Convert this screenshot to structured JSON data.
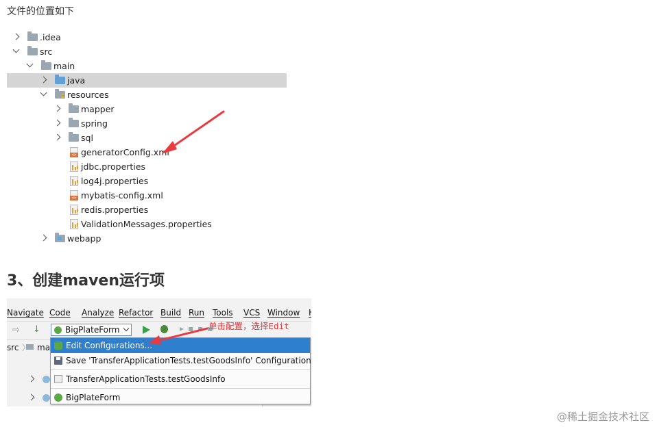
{
  "intro": "文件的位置如下",
  "tree": [
    {
      "label": ".idea",
      "indent": 0,
      "expander": "right",
      "icon": "folder",
      "selected": false
    },
    {
      "label": "src",
      "indent": 0,
      "expander": "down",
      "icon": "folder",
      "selected": false
    },
    {
      "label": "main",
      "indent": 1,
      "expander": "down",
      "icon": "folder",
      "selected": false
    },
    {
      "label": "java",
      "indent": 2,
      "expander": "right",
      "icon": "folder-blue",
      "selected": true
    },
    {
      "label": "resources",
      "indent": 2,
      "expander": "down",
      "icon": "folder-res",
      "selected": false
    },
    {
      "label": "mapper",
      "indent": 3,
      "expander": "right",
      "icon": "folder",
      "selected": false
    },
    {
      "label": "spring",
      "indent": 3,
      "expander": "right",
      "icon": "folder",
      "selected": false
    },
    {
      "label": "sql",
      "indent": 3,
      "expander": "right",
      "icon": "folder",
      "selected": false
    },
    {
      "label": "generatorConfig.xml",
      "indent": 3,
      "expander": "none",
      "icon": "xml",
      "selected": false
    },
    {
      "label": "jdbc.properties",
      "indent": 3,
      "expander": "none",
      "icon": "prop",
      "selected": false
    },
    {
      "label": "log4j.properties",
      "indent": 3,
      "expander": "none",
      "icon": "prop",
      "selected": false
    },
    {
      "label": "mybatis-config.xml",
      "indent": 3,
      "expander": "none",
      "icon": "xml",
      "selected": false
    },
    {
      "label": "redis.properties",
      "indent": 3,
      "expander": "none",
      "icon": "prop",
      "selected": false
    },
    {
      "label": "ValidationMessages.properties",
      "indent": 3,
      "expander": "none",
      "icon": "prop",
      "selected": false
    },
    {
      "label": "webapp",
      "indent": 2,
      "expander": "right",
      "icon": "folder-web",
      "selected": false
    }
  ],
  "heading": "3、创建maven运行项",
  "ide": {
    "menu": [
      "Navigate",
      "Code",
      "Analyze",
      "Refactor",
      "Build",
      "Run",
      "Tools",
      "VCS",
      "Window",
      "H"
    ],
    "run_config": "BigPlateForm",
    "annotation": "单击配置，选择Edit",
    "crumb_src": "src",
    "crumb_main": "ma",
    "popup": [
      {
        "label": "Edit Configurations...",
        "icon": "gear-icon",
        "highlighted": true
      },
      {
        "label": "Save 'TransferApplicationTests.testGoodsInfo' Configuration",
        "icon": "save-icon",
        "highlighted": false
      },
      {
        "label": "TransferApplicationTests.testGoodsInfo",
        "icon": "test-icon",
        "highlighted": false
      },
      {
        "label": "BigPlateForm",
        "icon": "spring-boot-icon",
        "highlighted": false
      }
    ]
  },
  "watermark": "@稀土掘金技术社区",
  "colors": {
    "selection": "#d5d5d5",
    "highlight": "#2f7fcf",
    "annotation": "#e0393d"
  }
}
